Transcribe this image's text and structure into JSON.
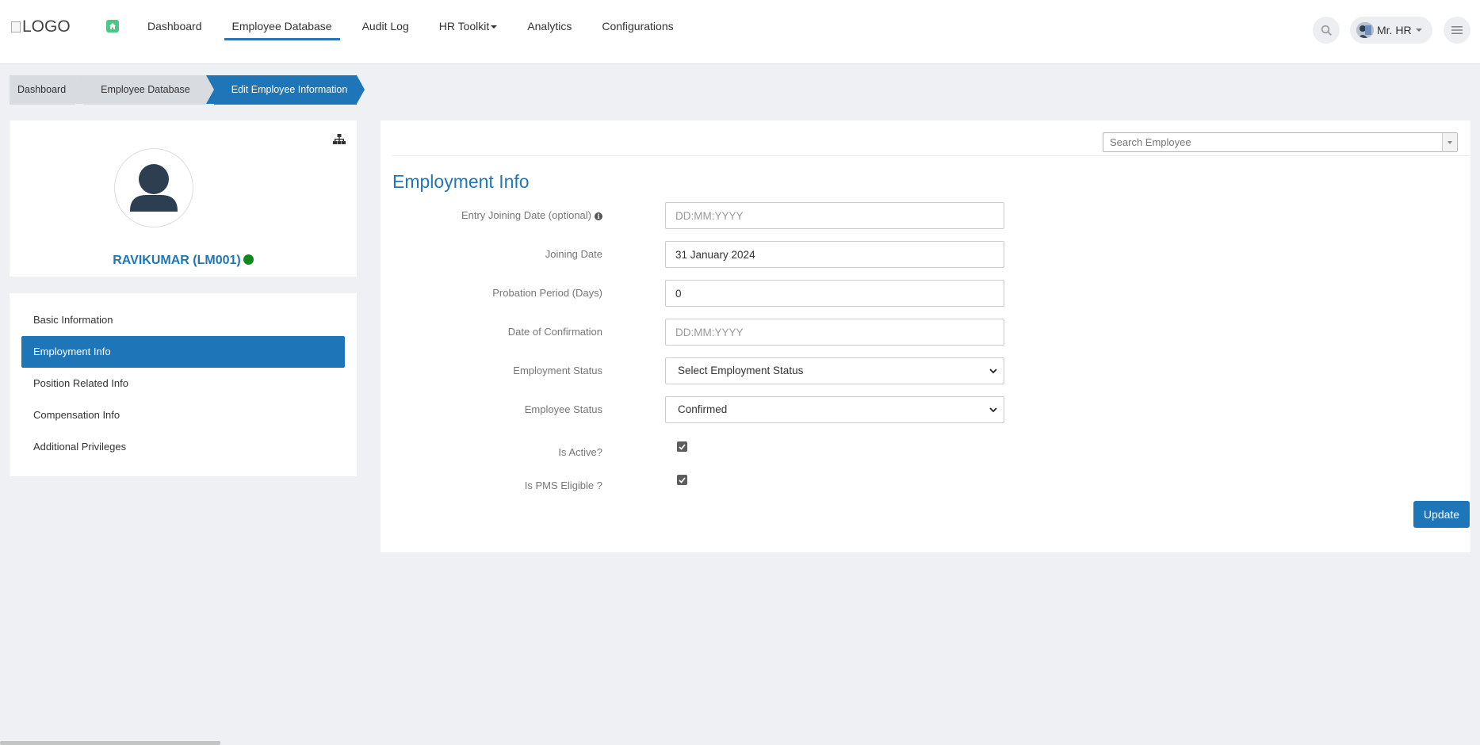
{
  "header": {
    "logo_text": "LOGO",
    "nav": [
      {
        "label": "Dashboard"
      },
      {
        "label": "Employee Database"
      },
      {
        "label": "Audit Log"
      },
      {
        "label": "HR Toolkit"
      },
      {
        "label": "Analytics"
      },
      {
        "label": "Configurations"
      }
    ],
    "active_nav": "Employee Database",
    "user_name": "Mr. HR"
  },
  "breadcrumb": [
    {
      "label": "Dashboard"
    },
    {
      "label": "Employee Database"
    },
    {
      "label": "Edit Employee Information"
    }
  ],
  "profile": {
    "name": "RAVIKUMAR (LM001)",
    "status_color": "#0f8a1a"
  },
  "side_menu": [
    {
      "label": "Basic Information"
    },
    {
      "label": "Employment Info"
    },
    {
      "label": "Position Related Info"
    },
    {
      "label": "Compensation Info"
    },
    {
      "label": "Additional Privileges"
    }
  ],
  "active_menu": "Employment Info",
  "main": {
    "search_placeholder": "Search Employee",
    "section_title": "Employment Info",
    "fields": {
      "entry_joining": {
        "label": "Entry Joining Date (optional)",
        "value": "",
        "placeholder": "DD:MM:YYYY"
      },
      "joining": {
        "label": "Joining Date",
        "value": "31 January 2024",
        "placeholder": "DD:MM:YYYY"
      },
      "probation": {
        "label": "Probation Period (Days)",
        "value": "0",
        "placeholder": ""
      },
      "confirmation": {
        "label": "Date of Confirmation",
        "value": "",
        "placeholder": "DD:MM:YYYY"
      },
      "employment_status": {
        "label": "Employment Status",
        "value": "Select Employment Status"
      },
      "employee_status": {
        "label": "Employee Status",
        "value": "Confirmed"
      },
      "is_active": {
        "label": "Is Active?",
        "checked": true
      },
      "is_pms": {
        "label": "Is PMS Eligible ?",
        "checked": true
      }
    },
    "update_label": "Update"
  },
  "colors": {
    "accent": "#1e76b8",
    "title": "#2377b9",
    "home": "#4fc586",
    "background": "#eff0f4"
  }
}
